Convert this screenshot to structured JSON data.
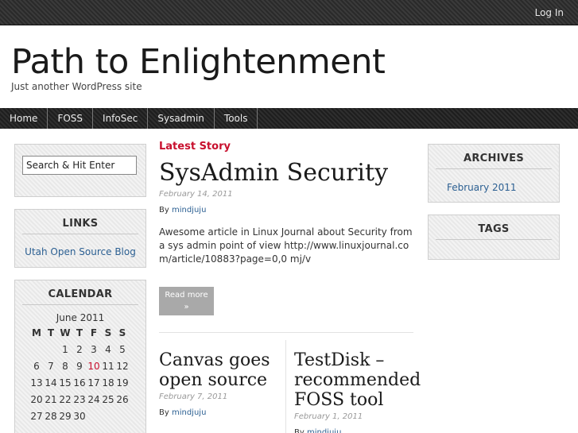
{
  "topbar": {
    "login_label": "Log In"
  },
  "header": {
    "title": "Path to Enlightenment",
    "description": "Just another WordPress site"
  },
  "nav": {
    "items": [
      "Home",
      "FOSS",
      "InfoSec",
      "Sysadmin",
      "Tools"
    ]
  },
  "sidebar_left": {
    "search_placeholder": "Search & Hit Enter",
    "links": {
      "title": "LINKS",
      "items": [
        "Utah Open Source Blog"
      ]
    },
    "calendar": {
      "title": "CALENDAR",
      "caption": "June 2011",
      "weekdays": [
        "M",
        "T",
        "W",
        "T",
        "F",
        "S",
        "S"
      ],
      "weeks": [
        [
          "",
          "",
          "1",
          "2",
          "3",
          "4",
          "5"
        ],
        [
          "6",
          "7",
          "8",
          "9",
          "10",
          "11",
          "12"
        ],
        [
          "13",
          "14",
          "15",
          "16",
          "17",
          "18",
          "19"
        ],
        [
          "20",
          "21",
          "22",
          "23",
          "24",
          "25",
          "26"
        ],
        [
          "27",
          "28",
          "29",
          "30",
          "",
          "",
          ""
        ]
      ],
      "today": "10"
    }
  },
  "main": {
    "latest_label": "Latest Story",
    "featured": {
      "title": "SysAdmin Security",
      "date": "February 14, 2011",
      "by_prefix": "By",
      "author": "mindjuju",
      "excerpt": "Awesome article in Linux Journal about Security from a sys admin point of view http://www.linuxjournal.com/article/10883?page=0,0 mj/v",
      "read_more": "Read more",
      "read_more_arrow": "»"
    },
    "posts": [
      {
        "title": "Canvas goes open source",
        "date": "February 7, 2011",
        "by_prefix": "By",
        "author": "mindjuju"
      },
      {
        "title": "TestDisk – recommended FOSS tool",
        "date": "February 1, 2011",
        "by_prefix": "By",
        "author": "mindjuju"
      }
    ]
  },
  "sidebar_right": {
    "archives": {
      "title": "ARCHIVES",
      "items": [
        "February 2011"
      ]
    },
    "tags": {
      "title": "TAGS"
    }
  }
}
